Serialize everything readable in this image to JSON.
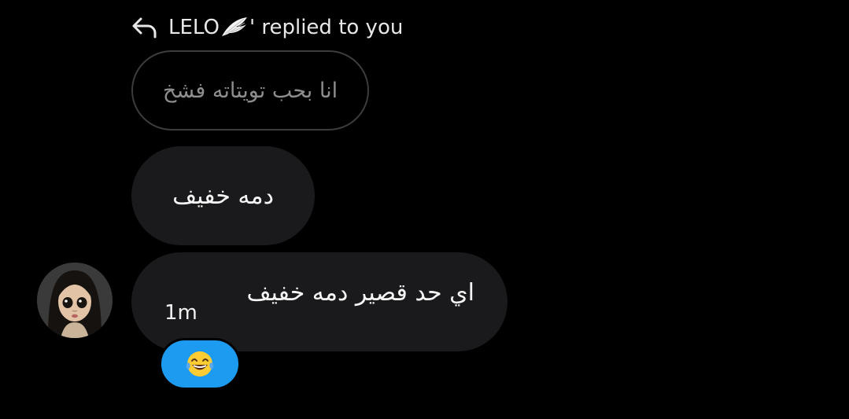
{
  "reply_header": {
    "name_prefix": "LELO",
    "name_suffix": "'",
    "action_text": " replied to you",
    "icon": "reply-arrow-icon",
    "name_emoji": "wing-icon"
  },
  "quoted_message": {
    "text": "انا بحب تويتاته فشخ"
  },
  "messages": [
    {
      "text": "دمه خفيف"
    },
    {
      "text": "اي حد قصير دمه خفيف",
      "timestamp": "1m"
    }
  ],
  "reaction": {
    "emoji": "face-with-tears-of-joy-icon",
    "color": "#1d9bf0"
  },
  "colors": {
    "background": "#000000",
    "bubble": "#1a1a1c",
    "quoted_border": "#3d3d3f",
    "reaction": "#1d9bf0"
  }
}
